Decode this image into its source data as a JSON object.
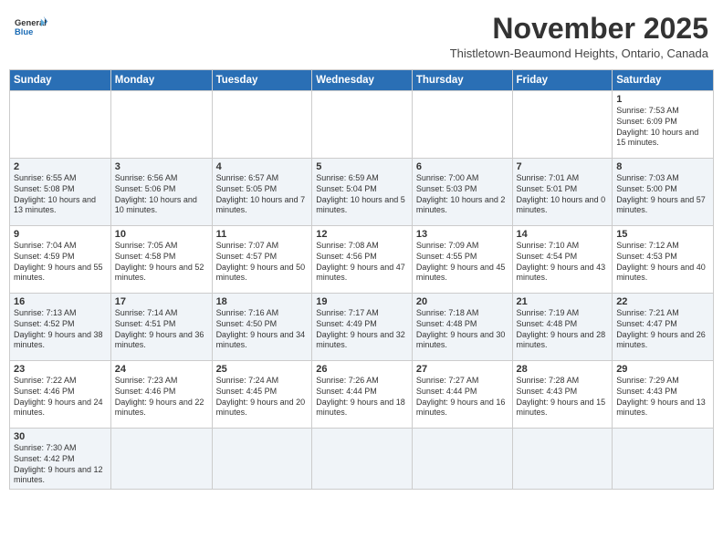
{
  "header": {
    "logo_general": "General",
    "logo_blue": "Blue",
    "month_title": "November 2025",
    "subtitle": "Thistletown-Beaumond Heights, Ontario, Canada"
  },
  "days_of_week": [
    "Sunday",
    "Monday",
    "Tuesday",
    "Wednesday",
    "Thursday",
    "Friday",
    "Saturday"
  ],
  "weeks": [
    {
      "days": [
        {
          "num": "",
          "info": ""
        },
        {
          "num": "",
          "info": ""
        },
        {
          "num": "",
          "info": ""
        },
        {
          "num": "",
          "info": ""
        },
        {
          "num": "",
          "info": ""
        },
        {
          "num": "",
          "info": ""
        },
        {
          "num": "1",
          "info": "Sunrise: 7:53 AM\nSunset: 6:09 PM\nDaylight: 10 hours and 15 minutes."
        }
      ]
    },
    {
      "days": [
        {
          "num": "2",
          "info": "Sunrise: 6:55 AM\nSunset: 5:08 PM\nDaylight: 10 hours and 13 minutes."
        },
        {
          "num": "3",
          "info": "Sunrise: 6:56 AM\nSunset: 5:06 PM\nDaylight: 10 hours and 10 minutes."
        },
        {
          "num": "4",
          "info": "Sunrise: 6:57 AM\nSunset: 5:05 PM\nDaylight: 10 hours and 7 minutes."
        },
        {
          "num": "5",
          "info": "Sunrise: 6:59 AM\nSunset: 5:04 PM\nDaylight: 10 hours and 5 minutes."
        },
        {
          "num": "6",
          "info": "Sunrise: 7:00 AM\nSunset: 5:03 PM\nDaylight: 10 hours and 2 minutes."
        },
        {
          "num": "7",
          "info": "Sunrise: 7:01 AM\nSunset: 5:01 PM\nDaylight: 10 hours and 0 minutes."
        },
        {
          "num": "8",
          "info": "Sunrise: 7:03 AM\nSunset: 5:00 PM\nDaylight: 9 hours and 57 minutes."
        }
      ]
    },
    {
      "days": [
        {
          "num": "9",
          "info": "Sunrise: 7:04 AM\nSunset: 4:59 PM\nDaylight: 9 hours and 55 minutes."
        },
        {
          "num": "10",
          "info": "Sunrise: 7:05 AM\nSunset: 4:58 PM\nDaylight: 9 hours and 52 minutes."
        },
        {
          "num": "11",
          "info": "Sunrise: 7:07 AM\nSunset: 4:57 PM\nDaylight: 9 hours and 50 minutes."
        },
        {
          "num": "12",
          "info": "Sunrise: 7:08 AM\nSunset: 4:56 PM\nDaylight: 9 hours and 47 minutes."
        },
        {
          "num": "13",
          "info": "Sunrise: 7:09 AM\nSunset: 4:55 PM\nDaylight: 9 hours and 45 minutes."
        },
        {
          "num": "14",
          "info": "Sunrise: 7:10 AM\nSunset: 4:54 PM\nDaylight: 9 hours and 43 minutes."
        },
        {
          "num": "15",
          "info": "Sunrise: 7:12 AM\nSunset: 4:53 PM\nDaylight: 9 hours and 40 minutes."
        }
      ]
    },
    {
      "days": [
        {
          "num": "16",
          "info": "Sunrise: 7:13 AM\nSunset: 4:52 PM\nDaylight: 9 hours and 38 minutes."
        },
        {
          "num": "17",
          "info": "Sunrise: 7:14 AM\nSunset: 4:51 PM\nDaylight: 9 hours and 36 minutes."
        },
        {
          "num": "18",
          "info": "Sunrise: 7:16 AM\nSunset: 4:50 PM\nDaylight: 9 hours and 34 minutes."
        },
        {
          "num": "19",
          "info": "Sunrise: 7:17 AM\nSunset: 4:49 PM\nDaylight: 9 hours and 32 minutes."
        },
        {
          "num": "20",
          "info": "Sunrise: 7:18 AM\nSunset: 4:48 PM\nDaylight: 9 hours and 30 minutes."
        },
        {
          "num": "21",
          "info": "Sunrise: 7:19 AM\nSunset: 4:48 PM\nDaylight: 9 hours and 28 minutes."
        },
        {
          "num": "22",
          "info": "Sunrise: 7:21 AM\nSunset: 4:47 PM\nDaylight: 9 hours and 26 minutes."
        }
      ]
    },
    {
      "days": [
        {
          "num": "23",
          "info": "Sunrise: 7:22 AM\nSunset: 4:46 PM\nDaylight: 9 hours and 24 minutes."
        },
        {
          "num": "24",
          "info": "Sunrise: 7:23 AM\nSunset: 4:46 PM\nDaylight: 9 hours and 22 minutes."
        },
        {
          "num": "25",
          "info": "Sunrise: 7:24 AM\nSunset: 4:45 PM\nDaylight: 9 hours and 20 minutes."
        },
        {
          "num": "26",
          "info": "Sunrise: 7:26 AM\nSunset: 4:44 PM\nDaylight: 9 hours and 18 minutes."
        },
        {
          "num": "27",
          "info": "Sunrise: 7:27 AM\nSunset: 4:44 PM\nDaylight: 9 hours and 16 minutes."
        },
        {
          "num": "28",
          "info": "Sunrise: 7:28 AM\nSunset: 4:43 PM\nDaylight: 9 hours and 15 minutes."
        },
        {
          "num": "29",
          "info": "Sunrise: 7:29 AM\nSunset: 4:43 PM\nDaylight: 9 hours and 13 minutes."
        }
      ]
    },
    {
      "days": [
        {
          "num": "30",
          "info": "Sunrise: 7:30 AM\nSunset: 4:42 PM\nDaylight: 9 hours and 12 minutes."
        },
        {
          "num": "",
          "info": ""
        },
        {
          "num": "",
          "info": ""
        },
        {
          "num": "",
          "info": ""
        },
        {
          "num": "",
          "info": ""
        },
        {
          "num": "",
          "info": ""
        },
        {
          "num": "",
          "info": ""
        }
      ]
    }
  ]
}
